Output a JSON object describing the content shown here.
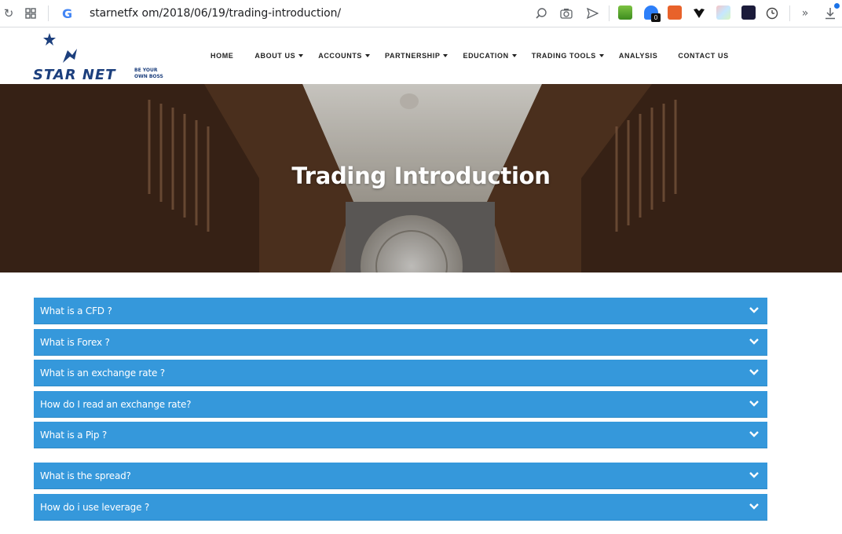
{
  "browser": {
    "url": "starnetfx om/2018/06/19/trading-introduction/",
    "extension_badge": "0"
  },
  "site": {
    "logo_text": "STARNET",
    "logo_tagline": "BE YOUR OWN BOSS"
  },
  "nav": {
    "items": [
      {
        "label": "HOME",
        "dropdown": false
      },
      {
        "label": "ABOUT US",
        "dropdown": true
      },
      {
        "label": "ACCOUNTS",
        "dropdown": true
      },
      {
        "label": "PARTNERSHIP",
        "dropdown": true
      },
      {
        "label": "EDUCATION",
        "dropdown": true
      },
      {
        "label": "TRADING TOOLS",
        "dropdown": true
      },
      {
        "label": "ANALYSIS",
        "dropdown": false
      },
      {
        "label": "CONTACT US",
        "dropdown": false
      }
    ]
  },
  "hero": {
    "title": "Trading Introduction"
  },
  "faq": {
    "accent": "#3598db",
    "items": [
      {
        "label": "What is a CFD ?"
      },
      {
        "label": "What is Forex ?"
      },
      {
        "label": "What is an exchange rate ?"
      },
      {
        "label": "How do I read an exchange rate?"
      },
      {
        "label": "What is a Pip ?"
      },
      {
        "label": "What is the spread?"
      },
      {
        "label": "How do i use leverage ?"
      }
    ]
  }
}
